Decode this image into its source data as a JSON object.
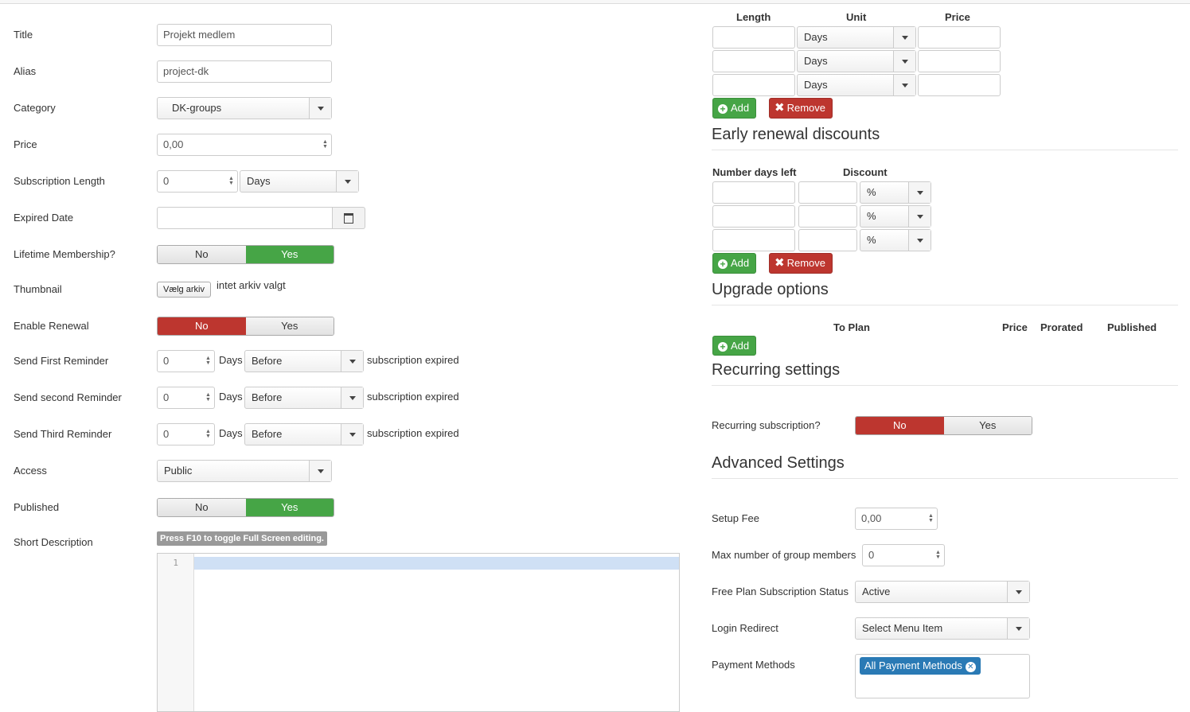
{
  "left": {
    "title": {
      "label": "Title",
      "value": "Projekt medlem"
    },
    "alias": {
      "label": "Alias",
      "value": "project-dk"
    },
    "category": {
      "label": "Category",
      "value": "DK-groups"
    },
    "price": {
      "label": "Price",
      "value": "0,00"
    },
    "subscription_length": {
      "label": "Subscription Length",
      "value": "0",
      "unit": "Days"
    },
    "expired_date": {
      "label": "Expired Date",
      "value": ""
    },
    "lifetime": {
      "label": "Lifetime Membership?",
      "no": "No",
      "yes": "Yes",
      "selected": "Yes"
    },
    "thumbnail": {
      "label": "Thumbnail",
      "button": "Vælg arkiv",
      "status": "intet arkiv valgt"
    },
    "enable_renewal": {
      "label": "Enable Renewal",
      "no": "No",
      "yes": "Yes",
      "selected": "No"
    },
    "reminders": [
      {
        "label": "Send First Reminder",
        "value": "0",
        "unit": "Days",
        "when": "Before",
        "suffix": "subscription expired"
      },
      {
        "label": "Send second Reminder",
        "value": "0",
        "unit": "Days",
        "when": "Before",
        "suffix": "subscription expired"
      },
      {
        "label": "Send Third Reminder",
        "value": "0",
        "unit": "Days",
        "when": "Before",
        "suffix": "subscription expired"
      }
    ],
    "access": {
      "label": "Access",
      "value": "Public"
    },
    "published": {
      "label": "Published",
      "no": "No",
      "yes": "Yes",
      "selected": "Yes"
    },
    "short_description": {
      "label": "Short Description",
      "tip": "Press F10 to toggle Full Screen editing.",
      "line_number": "1"
    }
  },
  "right": {
    "renewal": {
      "headers": {
        "length": "Length",
        "unit": "Unit",
        "price": "Price"
      },
      "rows": [
        {
          "length": "",
          "unit": "Days",
          "price": ""
        },
        {
          "length": "",
          "unit": "Days",
          "price": ""
        },
        {
          "length": "",
          "unit": "Days",
          "price": ""
        }
      ],
      "add": "Add",
      "remove": "Remove"
    },
    "early_renewal": {
      "heading": "Early renewal discounts",
      "headers": {
        "days": "Number days left",
        "discount": "Discount"
      },
      "rows": [
        {
          "days": "",
          "discount": "",
          "type": "%"
        },
        {
          "days": "",
          "discount": "",
          "type": "%"
        },
        {
          "days": "",
          "discount": "",
          "type": "%"
        }
      ],
      "add": "Add",
      "remove": "Remove"
    },
    "upgrade": {
      "heading": "Upgrade options",
      "headers": {
        "to_plan": "To Plan",
        "price": "Price",
        "prorated": "Prorated",
        "published": "Published"
      },
      "add": "Add"
    },
    "recurring": {
      "heading": "Recurring settings",
      "label": "Recurring subscription?",
      "no": "No",
      "yes": "Yes",
      "selected": "No"
    },
    "advanced": {
      "heading": "Advanced Settings",
      "setup_fee": {
        "label": "Setup Fee",
        "value": "0,00"
      },
      "max_members": {
        "label": "Max number of group members",
        "value": "0"
      },
      "free_status": {
        "label": "Free Plan Subscription Status",
        "value": "Active"
      },
      "login_redirect": {
        "label": "Login Redirect",
        "value": "Select Menu Item"
      },
      "payment_methods": {
        "label": "Payment Methods",
        "tag": "All Payment Methods"
      }
    }
  },
  "colors": {
    "green": "#46a546",
    "red": "#bd362f",
    "tag_blue": "#2a7ab5"
  }
}
